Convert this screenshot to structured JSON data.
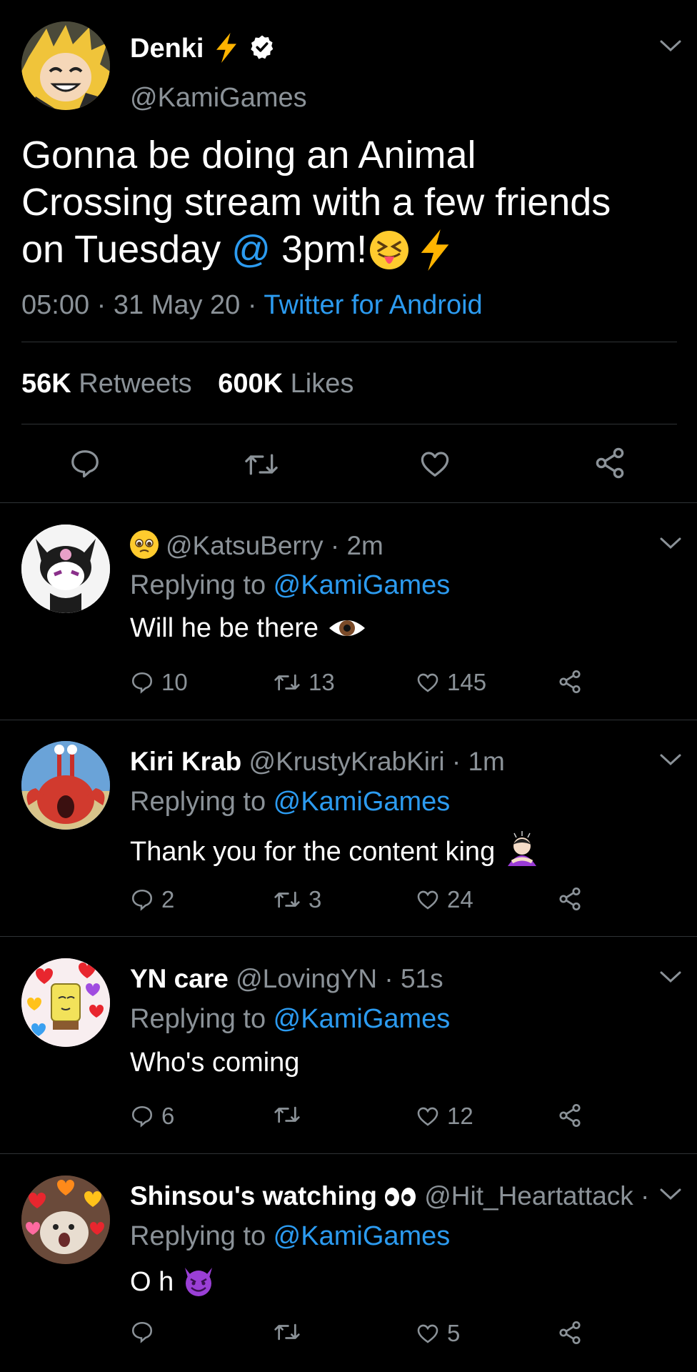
{
  "main_tweet": {
    "display_name": "Denki",
    "handle": "@KamiGames",
    "text_line1": "Gonna be doing an Animal",
    "text_line2": "Crossing stream with a few friends",
    "text_line3_pre": "on Tuesday ",
    "text_line3_at": "@",
    "text_line3_post": " 3pm!",
    "time": "05:00",
    "date": "31 May 20",
    "sep": " · ",
    "source": "Twitter for Android",
    "retweet_count": "56K",
    "retweet_label": " Retweets",
    "like_count": "600K",
    "like_label": " Likes"
  },
  "replies": [
    {
      "name": "",
      "handle": "@KatsuBerry",
      "time": " · 2m",
      "replying_label": "Replying to ",
      "replying_to": "@KamiGames",
      "text": "Will he be there",
      "reply_count": "10",
      "retweet_count": "13",
      "like_count": "145"
    },
    {
      "name": "Kiri Krab",
      "handle": " @KrustyKrabKiri",
      "time": " · 1m",
      "replying_label": "Replying to ",
      "replying_to": "@KamiGames",
      "text": "Thank you for the content king",
      "reply_count": "2",
      "retweet_count": "3",
      "like_count": "24"
    },
    {
      "name": "YN care",
      "handle": " @LovingYN",
      "time": " · 51s",
      "replying_label": "Replying to ",
      "replying_to": "@KamiGames",
      "text": "Who's coming",
      "reply_count": "6",
      "retweet_count": "",
      "like_count": "12"
    },
    {
      "name": "Shinsou's watching",
      "handle": " @Hit_Heartattack",
      "time": " ·",
      "replying_label": "Replying to ",
      "replying_to": "@KamiGames",
      "text": "O h",
      "reply_count": "",
      "retweet_count": "",
      "like_count": "5"
    }
  ],
  "colors": {
    "accent": "#2c9bf0",
    "muted": "#8b9298",
    "divider": "#2f3336",
    "background": "#000000"
  }
}
